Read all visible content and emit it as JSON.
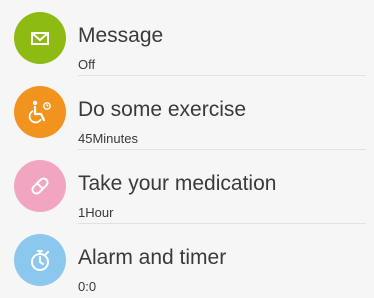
{
  "items": [
    {
      "icon": "envelope-icon",
      "color": "#8dbb14",
      "title": "Message",
      "subtitle": "Off"
    },
    {
      "icon": "exercise-icon",
      "color": "#f2931e",
      "title": "Do some exercise",
      "subtitle": "45Minutes"
    },
    {
      "icon": "medication-icon",
      "color": "#f2a5c1",
      "title": "Take your medication",
      "subtitle": "1Hour"
    },
    {
      "icon": "stopwatch-icon",
      "color": "#8cc8ee",
      "title": "Alarm and timer",
      "subtitle": "0:0"
    }
  ]
}
